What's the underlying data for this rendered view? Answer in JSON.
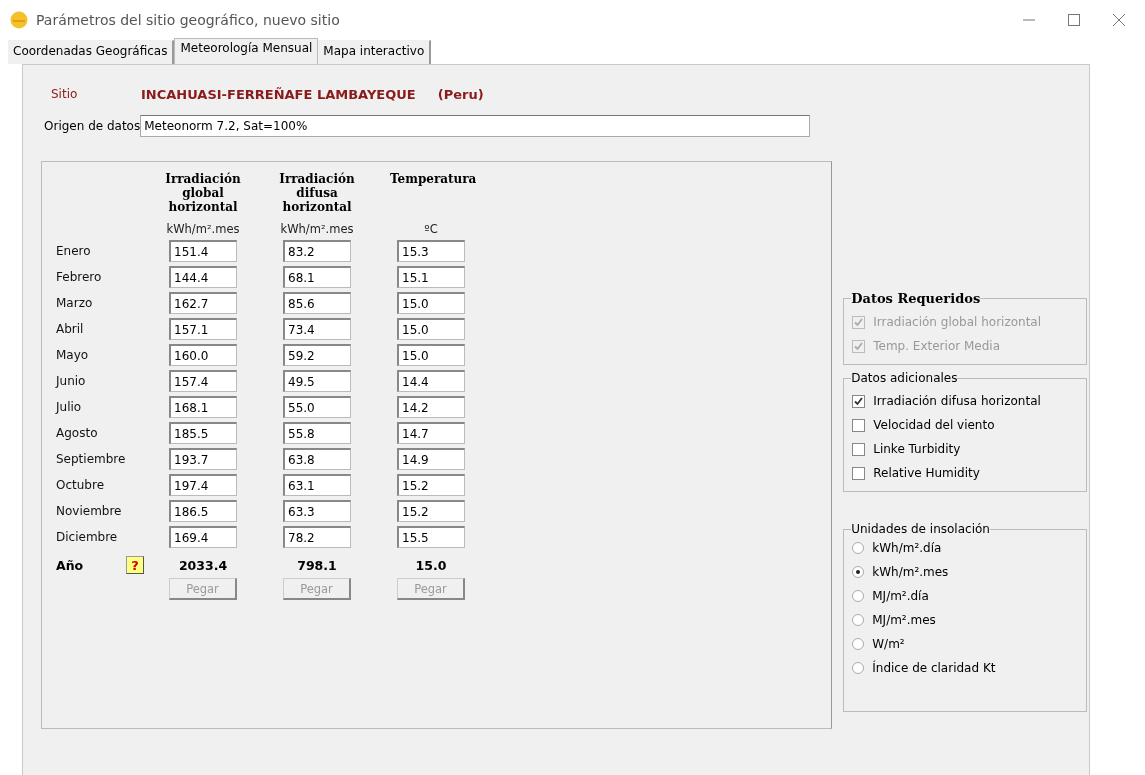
{
  "window": {
    "title": "Parámetros del sitio geográfico, nuevo sitio"
  },
  "tabs": [
    {
      "label": "Coordenadas Geográficas",
      "selected": false
    },
    {
      "label": "Meteorología Mensual",
      "selected": true
    },
    {
      "label": "Mapa interactivo",
      "selected": false
    }
  ],
  "site": {
    "label": "Sitio",
    "name": "INCAHUASI-FERREÑAFE LAMBAYEQUE",
    "country": "(Peru)"
  },
  "data_source": {
    "label": "Origen de datos",
    "value": "Meteonorm 7.2, Sat=100%"
  },
  "table": {
    "columns": [
      {
        "heading": "Irradiación global horizontal",
        "unit": "kWh/m².mes"
      },
      {
        "heading": "Irradiación difusa horizontal",
        "unit": "kWh/m².mes"
      },
      {
        "heading": "Temperatura",
        "unit": "ºC"
      }
    ],
    "rows": [
      {
        "month": "Enero",
        "values": [
          "151.4",
          "83.2",
          "15.3"
        ]
      },
      {
        "month": "Febrero",
        "values": [
          "144.4",
          "68.1",
          "15.1"
        ]
      },
      {
        "month": "Marzo",
        "values": [
          "162.7",
          "85.6",
          "15.0"
        ]
      },
      {
        "month": "Abril",
        "values": [
          "157.1",
          "73.4",
          "15.0"
        ]
      },
      {
        "month": "Mayo",
        "values": [
          "160.0",
          "59.2",
          "15.0"
        ]
      },
      {
        "month": "Junio",
        "values": [
          "157.4",
          "49.5",
          "14.4"
        ]
      },
      {
        "month": "Julio",
        "values": [
          "168.1",
          "55.0",
          "14.2"
        ]
      },
      {
        "month": "Agosto",
        "values": [
          "185.5",
          "55.8",
          "14.7"
        ]
      },
      {
        "month": "Septiembre",
        "values": [
          "193.7",
          "63.8",
          "14.9"
        ]
      },
      {
        "month": "Octubre",
        "values": [
          "197.4",
          "63.1",
          "15.2"
        ]
      },
      {
        "month": "Noviembre",
        "values": [
          "186.5",
          "63.3",
          "15.2"
        ]
      },
      {
        "month": "Diciembre",
        "values": [
          "169.4",
          "78.2",
          "15.5"
        ]
      }
    ],
    "total": {
      "label": "Año",
      "help": "?",
      "values": [
        "2033.4",
        "798.1",
        "15.0"
      ]
    },
    "paste_buttons": [
      {
        "label": "Pegar",
        "disabled": true
      },
      {
        "label": "Pegar",
        "disabled": true
      },
      {
        "label": "Pegar",
        "disabled": true
      }
    ]
  },
  "required": {
    "title": "Datos Requeridos",
    "items": [
      {
        "label": "Irradiación global horizontal",
        "checked": true,
        "disabled": true
      },
      {
        "label": "Temp. Exterior Media",
        "checked": true,
        "disabled": true
      }
    ]
  },
  "additional": {
    "title": "Datos adicionales",
    "items": [
      {
        "label": "Irradiación difusa horizontal",
        "checked": true,
        "disabled": false
      },
      {
        "label": "Velocidad del viento",
        "checked": false,
        "disabled": false
      },
      {
        "label": "Linke Turbidity",
        "checked": false,
        "disabled": false
      },
      {
        "label": "Relative Humidity",
        "checked": false,
        "disabled": false
      }
    ]
  },
  "units": {
    "title": "Unidades de insolación",
    "options": [
      {
        "label": "kWh/m².día",
        "selected": false
      },
      {
        "label": "kWh/m².mes",
        "selected": true
      },
      {
        "label": "MJ/m².día",
        "selected": false
      },
      {
        "label": "MJ/m².mes",
        "selected": false
      },
      {
        "label": "W/m²",
        "selected": false
      },
      {
        "label": "Índice de claridad Kt",
        "selected": false
      }
    ]
  }
}
